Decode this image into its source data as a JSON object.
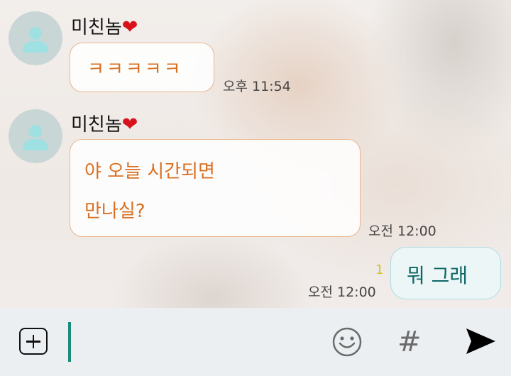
{
  "conversation": {
    "messages": [
      {
        "sender": "미친놈",
        "sender_emoji": "❤",
        "text": "ㅋㅋㅋㅋㅋ",
        "time": "오후 11:54",
        "direction": "incoming"
      },
      {
        "sender": "미친놈",
        "sender_emoji": "❤",
        "text_lines": [
          "야 오늘 시간되면",
          "만나실?"
        ],
        "time": "오전 12:00",
        "direction": "incoming"
      },
      {
        "text": "뭐 그래",
        "time": "오전 12:00",
        "unread_count": "1",
        "direction": "outgoing"
      }
    ]
  },
  "composer": {
    "plus_icon": "plus-square-icon",
    "emoji_icon": "smiley-icon",
    "hash_label": "#",
    "send_icon": "send-arrow-icon"
  },
  "colors": {
    "incoming_text": "#d96f21",
    "incoming_border": "#ecb58d",
    "outgoing_text": "#0d6765",
    "outgoing_border": "#a9dde3",
    "cursor": "#1a8c79",
    "heart": "#d8121c"
  }
}
